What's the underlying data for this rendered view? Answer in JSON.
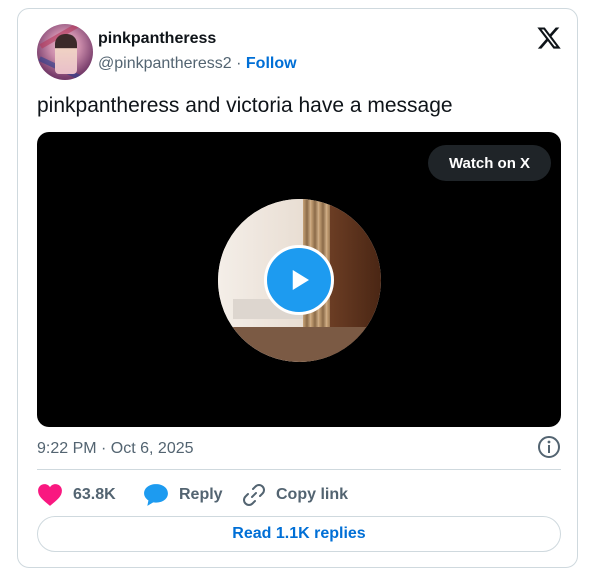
{
  "author": {
    "display_name": "pinkpantheress",
    "handle": "@pinkpantheress2",
    "separator": "·",
    "follow_label": "Follow"
  },
  "tweet": {
    "text": "pinkpantheress and victoria have a message",
    "timestamp": "9:22 PM · Oct 6, 2025"
  },
  "video": {
    "watch_label": "Watch on X"
  },
  "actions": {
    "like_count": "63.8K",
    "reply_label": "Reply",
    "copy_link_label": "Copy link",
    "read_replies_label": "Read 1.1K replies"
  },
  "colors": {
    "like": "#f91880",
    "reply": "#1d9bf0",
    "link": "#006fd6",
    "muted": "#536471"
  },
  "icons": {
    "brand": "x-logo-icon",
    "play": "play-icon",
    "info": "info-icon",
    "like": "heart-icon",
    "reply": "speech-bubble-icon",
    "copy_link": "link-icon"
  }
}
